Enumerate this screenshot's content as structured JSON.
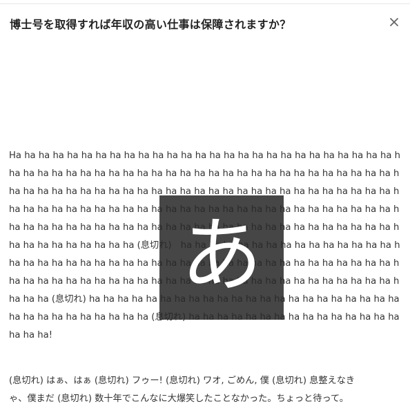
{
  "header": {
    "title": "博士号を取得すれば年収の高い仕事は保障されますか？",
    "close_icon": "close-icon"
  },
  "body": {
    "laugh_lines": [
      "Ha ha ha ha ha ha ha ha ha ha ha ha ha ha ha ha ha ha ha ha ha ha ha ha ha ha ha ha",
      "ha ha ha ha ha ha ha ha ha ha ha ha ha ha ha ha ha ha ha ha ha ha ha ha ha ha ha ha",
      "ha ha ha ha ha ha ha ha ha ha ha ha ha ha ha ha ha ha ha ha ha ha ha ha ha ha ha ha",
      "ha ha ha ha ha ha ha ha ha ha ha ha ha ha ha ha ha ha ha ha ha ha ha ha ha ha ha ha",
      "ha ha ha ha ha ha ha ha ha ha ha ha ha ha ha ha ha ha ha ha ha ha ha ha ha ha ha ha",
      "ha ha ha ha ha ha ha ha ha (息切れ)　ha ha ha ha ha ha ha ha ha ha ha ha ha ha ha ha",
      "ha ha ha ha ha ha ha ha ha ha ha ha ha ha ha ha ha ha ha ha ha ha ha ha ha ha ha ha",
      "ha ha ha ha ha ha ha ha ha ha ha ha ha ha ha ha ha ha ha ha ha ha ha ha ha ha ha ha",
      "ha ha ha (息切れ) ha ha ha ha ha ha ha ha ha ha ha ha ha ha ha ha ha ha ha ha ha ha ha",
      "ha ha ha ha ha ha ha ha ha ha (息切れ) ha ha ha ha ha ha ha ha ha ha ha ha ha ha ha",
      "ha ha ha!"
    ],
    "breath_lines": [
      "(息切れ) はぁ、はぁ (息切れ) フゥー! (息切れ) ワオ, ごめん, 僕 (息切れ) 息整えなき",
      "ゃ、僕まだ (息切れ) 数十年でこんなに大爆笑したことなかった。ちょっと待って。"
    ]
  },
  "overlay": {
    "glyph": "あ",
    "background": "#2b2b2b"
  },
  "colors": {
    "text": "#333333",
    "title": "#222222",
    "close": "#666666",
    "divider": "#e6e6e6"
  }
}
